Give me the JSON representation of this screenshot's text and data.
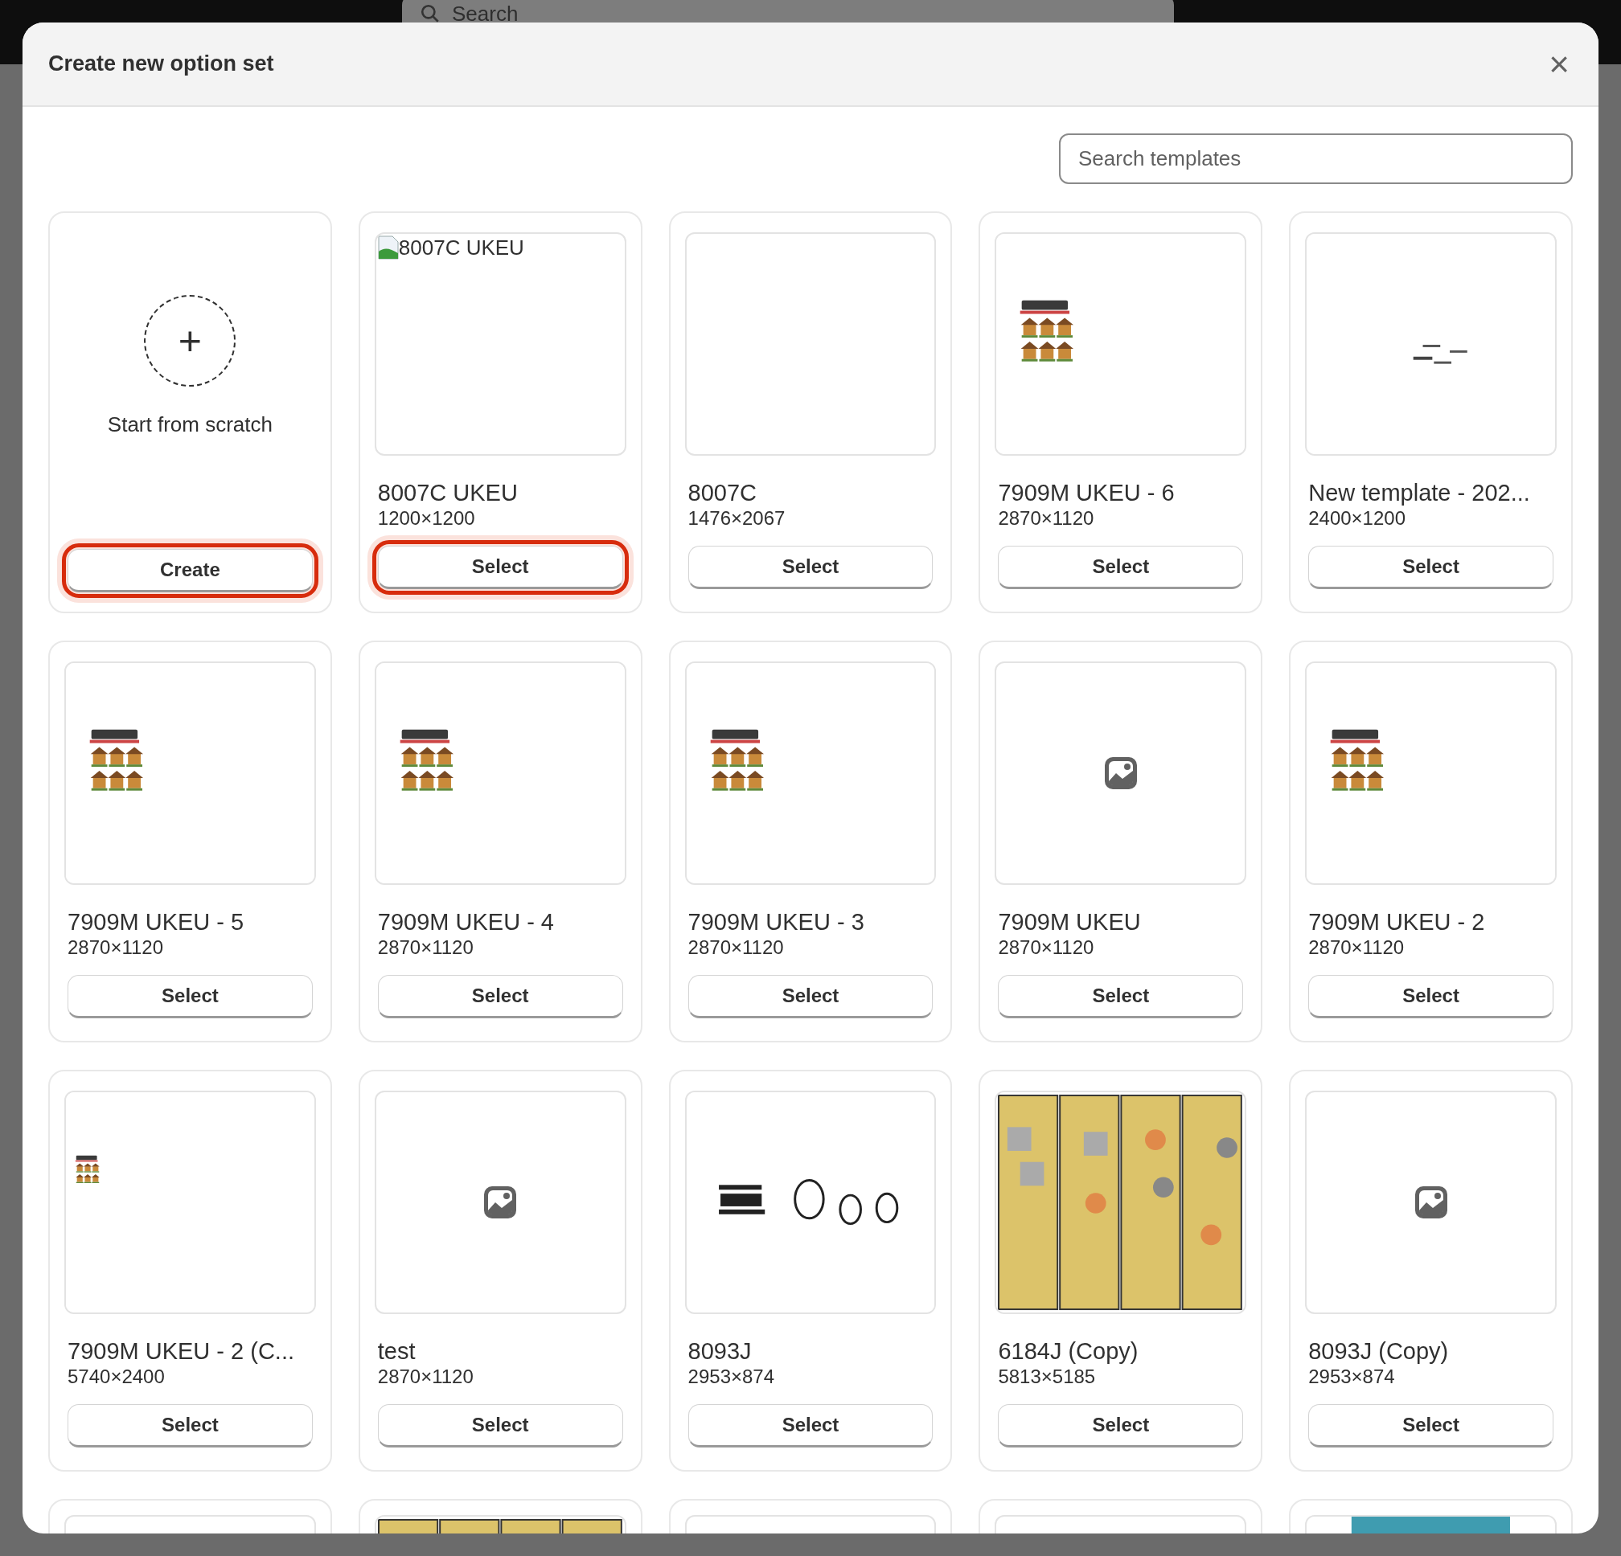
{
  "background_search": {
    "placeholder": "Search"
  },
  "dialog": {
    "title": "Create new option set",
    "close": "×"
  },
  "search": {
    "placeholder": "Search templates"
  },
  "scratch_card": {
    "label": "Start from scratch",
    "plus": "+",
    "button": {
      "label": "Create",
      "focused": true
    }
  },
  "templates": [
    {
      "name": "8007C UKEU",
      "size": "1200×1200",
      "kind": "broken",
      "alt": "8007C UKEU",
      "button": {
        "label": "Select",
        "focused": true
      }
    },
    {
      "name": "8007C",
      "size": "1476×2067",
      "kind": "blank",
      "button": {
        "label": "Select",
        "focused": false
      }
    },
    {
      "name": "7909M UKEU - 6",
      "size": "2870×1120",
      "kind": "houses",
      "button": {
        "label": "Select",
        "focused": false
      }
    },
    {
      "name": "New template - 202...",
      "size": "2400×1200",
      "kind": "labels",
      "button": {
        "label": "Select",
        "focused": false
      }
    },
    {
      "name": "7909M UKEU - 5",
      "size": "2870×1120",
      "kind": "houses",
      "button": {
        "label": "Select",
        "focused": false
      }
    },
    {
      "name": "7909M UKEU - 4",
      "size": "2870×1120",
      "kind": "houses",
      "button": {
        "label": "Select",
        "focused": false
      }
    },
    {
      "name": "7909M UKEU - 3",
      "size": "2870×1120",
      "kind": "houses",
      "button": {
        "label": "Select",
        "focused": false
      }
    },
    {
      "name": "7909M UKEU",
      "size": "2870×1120",
      "kind": "placeholder",
      "button": {
        "label": "Select",
        "focused": false
      }
    },
    {
      "name": "7909M UKEU - 2",
      "size": "2870×1120",
      "kind": "houses",
      "button": {
        "label": "Select",
        "focused": false
      }
    },
    {
      "name": "7909M UKEU - 2 (C...",
      "size": "5740×2400",
      "kind": "houses_small",
      "button": {
        "label": "Select",
        "focused": false
      }
    },
    {
      "name": "test",
      "size": "2870×1120",
      "kind": "placeholder",
      "button": {
        "label": "Select",
        "focused": false
      }
    },
    {
      "name": "8093J",
      "size": "2953×874",
      "kind": "doodle",
      "button": {
        "label": "Select",
        "focused": false
      }
    },
    {
      "name": "6184J (Copy)",
      "size": "5813×5185",
      "kind": "strips",
      "button": {
        "label": "Select",
        "focused": false
      }
    },
    {
      "name": "8093J (Copy)",
      "size": "2953×874",
      "kind": "placeholder",
      "button": {
        "label": "Select",
        "focused": false
      }
    }
  ],
  "partial_row": [
    {
      "kind": "blank"
    },
    {
      "kind": "strips"
    },
    {
      "kind": "blank"
    },
    {
      "kind": "blank"
    },
    {
      "kind": "teal"
    }
  ]
}
